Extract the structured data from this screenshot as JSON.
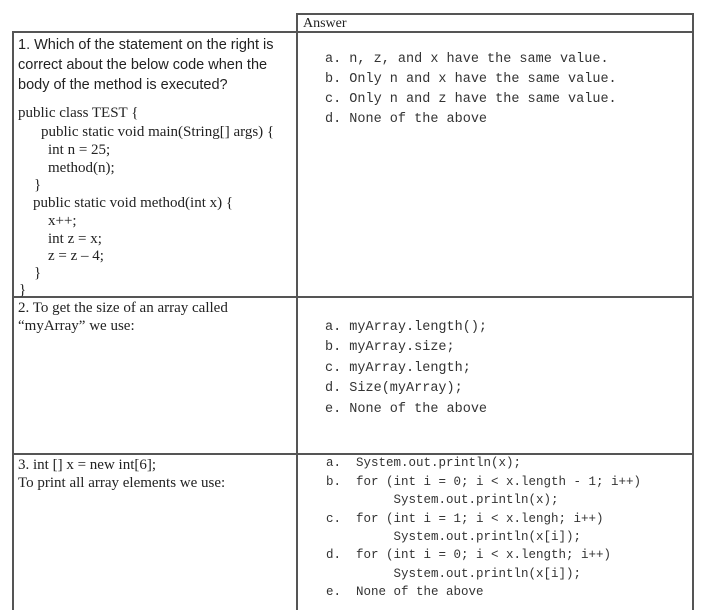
{
  "header": {
    "answer_label": "Answer"
  },
  "questions": [
    {
      "prompt_lines": [
        "1. Which of the statement on the right is",
        "correct about the below code when the",
        "body of the method is executed?"
      ],
      "code_lines": [
        "public class TEST {",
        "public static void main(String[] args) {",
        "int n = 25;",
        "method(n);",
        "}",
        "public static void method(int x) {",
        "x++;",
        "int z = x;",
        "z = z – 4;",
        "}",
        "}"
      ],
      "options": [
        "a. n, z, and x have the same value.",
        "b. Only n and x have the same value.",
        "c. Only n and z have the same value.",
        "d. None of the above"
      ]
    },
    {
      "prompt_lines": [
        "2. To get the size of an array called",
        "“myArray” we use:"
      ],
      "options": [
        "a. myArray.length();",
        "b. myArray.size;",
        "c. myArray.length;",
        "d. Size(myArray);",
        "e. None of the above"
      ]
    },
    {
      "prompt_lines": [
        "3. int [] x = new int[6];",
        "To print all array elements we use:"
      ],
      "options": [
        "a.  System.out.println(x);",
        "b.  for (int i = 0; i < x.length - 1; i++)",
        "         System.out.println(x);",
        "c.  for (int i = 1; i < x.lengh; i++)",
        "         System.out.println(x[i]);",
        "d.  for (int i = 0; i < x.length; i++)",
        "         System.out.println(x[i]);",
        "e.  None of the above"
      ]
    }
  ]
}
